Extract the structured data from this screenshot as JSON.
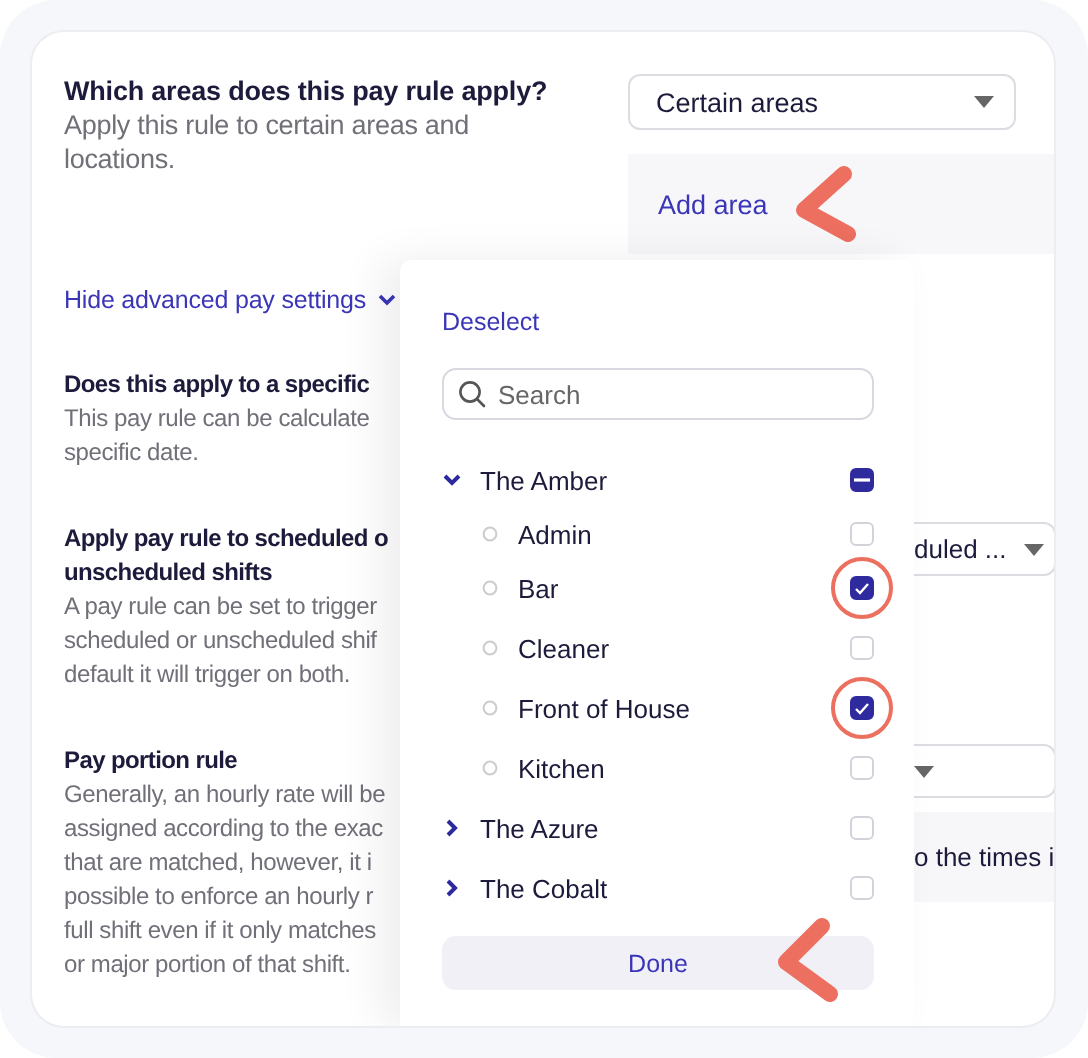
{
  "areas_question": {
    "title": "Which areas does this pay rule apply?",
    "description": [
      "Apply this rule to certain areas and",
      "locations."
    ],
    "select": {
      "value": "Certain areas"
    },
    "add_area": {
      "label": "Add area",
      "pointer_arrow": true
    }
  },
  "advanced_toggle": {
    "label": "Hide advanced pay settings",
    "expanded": true
  },
  "sections": [
    {
      "title": [
        "Does this apply to a specific"
      ],
      "description": [
        "This pay rule can be calculate",
        "specific date."
      ]
    },
    {
      "title": [
        "Apply pay rule to scheduled o",
        "unscheduled shifts"
      ],
      "description": [
        "A pay rule can be set to trigger",
        "scheduled or unscheduled shif",
        "default it will trigger on both."
      ],
      "select": {
        "value": "duled ..."
      }
    },
    {
      "title": [
        "Pay portion rule"
      ],
      "description": [
        "Generally, an hourly rate will be",
        "assigned according to the exac",
        "that are matched, however, it i",
        "possible to enforce an hourly r",
        "full shift even if it only matches",
        "or major portion of that shift."
      ],
      "dropdown": true,
      "note": "o the times i"
    }
  ],
  "area_picker": {
    "deselect": "Deselect",
    "search": {
      "placeholder": "Search"
    },
    "tree": [
      {
        "label": "The Amber",
        "expanded": true,
        "partially_checked": true,
        "children": [
          {
            "label": "Admin",
            "checked": false,
            "highlighted": false
          },
          {
            "label": "Bar",
            "checked": true,
            "highlighted": true
          },
          {
            "label": "Cleaner",
            "checked": false,
            "highlighted": false
          },
          {
            "label": "Front of House",
            "checked": true,
            "highlighted": true
          },
          {
            "label": "Kitchen",
            "checked": false,
            "highlighted": false
          }
        ]
      },
      {
        "label": "The Azure",
        "expanded": false,
        "checked": false
      },
      {
        "label": "The Cobalt",
        "expanded": false,
        "checked": false
      }
    ],
    "done": {
      "label": "Done",
      "pointer_arrow": true
    }
  }
}
